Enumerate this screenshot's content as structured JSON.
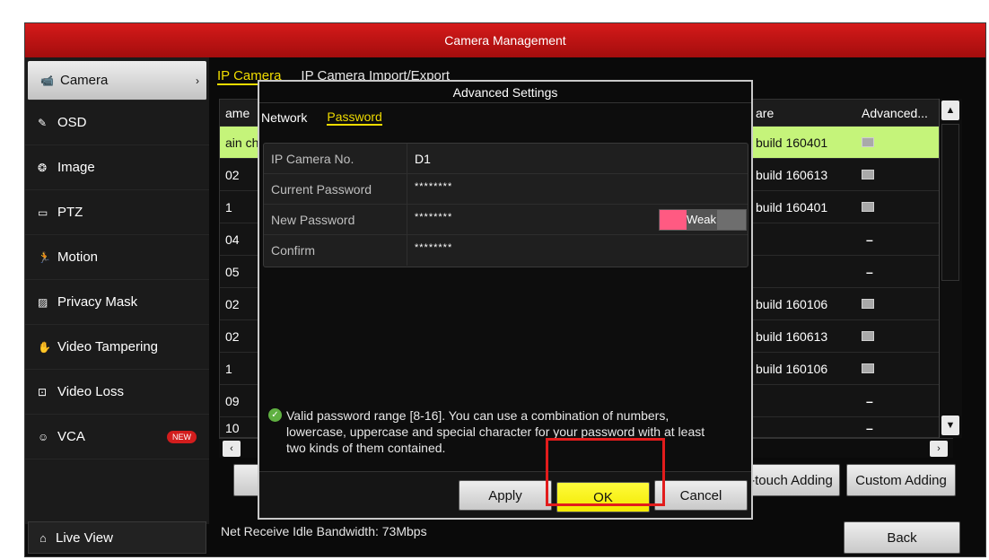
{
  "title": "Camera Management",
  "sidebar": {
    "items": [
      {
        "label": "Camera",
        "icon": "camera-icon",
        "glyph": "📹"
      },
      {
        "label": "OSD",
        "icon": "osd-icon",
        "glyph": "✎"
      },
      {
        "label": "Image",
        "icon": "image-icon",
        "glyph": "❂"
      },
      {
        "label": "PTZ",
        "icon": "ptz-icon",
        "glyph": "▭"
      },
      {
        "label": "Motion",
        "icon": "motion-icon",
        "glyph": "🏃"
      },
      {
        "label": "Privacy Mask",
        "icon": "privacy-mask-icon",
        "glyph": "▨"
      },
      {
        "label": "Video Tampering",
        "icon": "video-tampering-icon",
        "glyph": "✋"
      },
      {
        "label": "Video Loss",
        "icon": "video-loss-icon",
        "glyph": "⊡"
      },
      {
        "label": "VCA",
        "icon": "vca-icon",
        "glyph": "☺",
        "badge": "NEW"
      }
    ],
    "live_view": "Live View"
  },
  "tabs": [
    "IP Camera",
    "IP Camera Import/Export"
  ],
  "table": {
    "header_name": "ame",
    "header_firmware": "are",
    "header_advanced": "Advanced...",
    "rows": [
      {
        "name": "ain ch",
        "firmware": "build 160401",
        "adv": "icon"
      },
      {
        "name": "02",
        "firmware": "build 160613",
        "adv": "icon"
      },
      {
        "name": "1",
        "firmware": "build 160401",
        "adv": "icon"
      },
      {
        "name": "04",
        "firmware": "",
        "adv": "–"
      },
      {
        "name": "05",
        "firmware": "",
        "adv": "–"
      },
      {
        "name": "02",
        "firmware": "build 160106",
        "adv": "icon"
      },
      {
        "name": "02",
        "firmware": "build 160613",
        "adv": "icon"
      },
      {
        "name": "1",
        "firmware": "build 160106",
        "adv": "icon"
      },
      {
        "name": "09",
        "firmware": "",
        "adv": "–"
      },
      {
        "name": "10",
        "firmware": "",
        "adv": "–"
      }
    ]
  },
  "buttons": {
    "one_touch": "-touch Adding",
    "custom_adding": "Custom Adding",
    "back": "Back"
  },
  "bandwidth": "Net Receive Idle Bandwidth: 73Mbps",
  "dialog": {
    "title": "Advanced Settings",
    "tabs": [
      "Network",
      "Password"
    ],
    "fields": [
      {
        "label": "IP Camera No.",
        "value": "D1"
      },
      {
        "label": "Current Password",
        "value": "********"
      },
      {
        "label": "New Password",
        "value": "********"
      },
      {
        "label": "Confirm",
        "value": "********"
      }
    ],
    "strength": "Weak",
    "note": "Valid password range [8-16]. You can use a combination of numbers, lowercase, uppercase and special character for your password with at least two kinds of them contained.",
    "apply": "Apply",
    "ok": "OK",
    "cancel": "Cancel"
  },
  "colors": {
    "titlebar": "#c41414",
    "accent_tab": "#f0dc00",
    "selected_row": "#c5f47a",
    "ok_button": "#f7f000",
    "strength_weak": "#ff5a82",
    "highlight_box": "#e21c1c"
  }
}
